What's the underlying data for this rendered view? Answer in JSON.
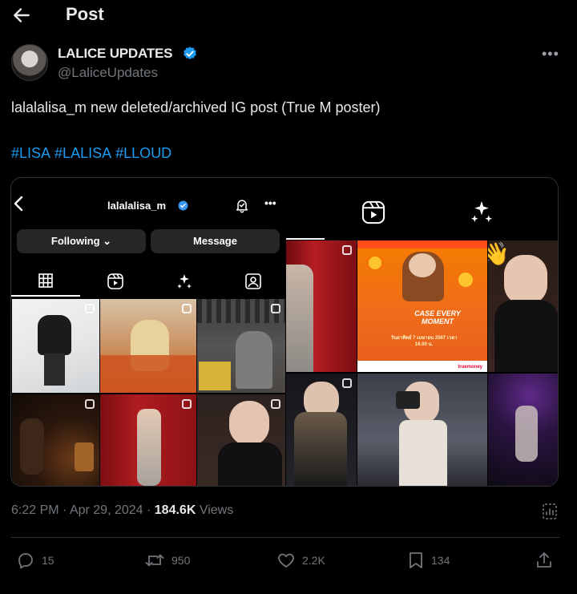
{
  "header": {
    "title": "Post",
    "back_icon": "back-arrow-icon"
  },
  "author": {
    "name": "LALICE UPDATES",
    "handle": "@LaliceUpdates",
    "verified": true,
    "accent": "#1d9bf0"
  },
  "tweet": {
    "text": "lalalalisa_m new deleted/archived IG post (True M poster)",
    "hashtags": [
      "#LISA",
      "#LALISA",
      "#LLOUD"
    ]
  },
  "embedded_screenshot": {
    "left_panel": {
      "username": "lalalalisa_m",
      "following_label": "Following",
      "message_label": "Message",
      "tabs": [
        "grid-icon",
        "reels-icon",
        "sparkles-icon",
        "tagged-icon"
      ]
    },
    "right_panel": {
      "tabs": [
        "reels-icon",
        "sparkles-icon"
      ],
      "poster": {
        "title": "CASE EVERY MOMENT",
        "date": "วันอาทิตย์ 7 เมษายน 2567 เวลา 16.00 น.",
        "brand": "truemoney"
      }
    }
  },
  "meta": {
    "time": "6:22 PM",
    "date": "Apr 29, 2024",
    "views_count": "184.6K",
    "views_label": "Views"
  },
  "actions": {
    "replies": "15",
    "retweets": "950",
    "likes": "2.2K",
    "bookmarks": "134"
  }
}
